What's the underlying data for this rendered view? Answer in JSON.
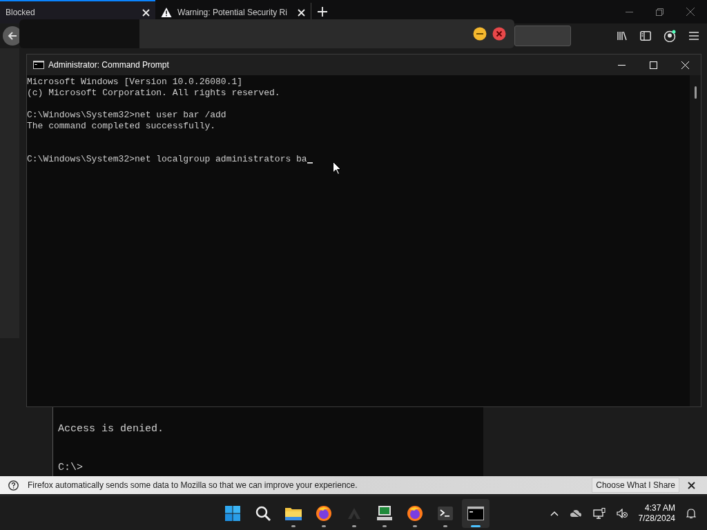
{
  "browser": {
    "tabs": [
      {
        "label": "Blocked",
        "selected": true,
        "kind": "plain"
      },
      {
        "label": "Warning: Potential Security Ri",
        "selected": false,
        "kind": "warning"
      }
    ]
  },
  "notification": {
    "message": "Firefox automatically sends some data to Mozilla so that we can improve your experience.",
    "button": "Choose What I Share"
  },
  "background_console": {
    "lines": [
      "Access is denied.",
      "C:\\>"
    ]
  },
  "command_prompt": {
    "title": "Administrator: Command Prompt",
    "cursor_visible": true,
    "lines": [
      {
        "kind": "text",
        "text": "Microsoft Windows [Version 10.0.26080.1]"
      },
      {
        "kind": "text",
        "text": "(c) Microsoft Corporation. All rights reserved."
      },
      {
        "kind": "blank"
      },
      {
        "kind": "text",
        "text": "C:\\Windows\\System32>net user bar /add"
      },
      {
        "kind": "text",
        "text": "The command completed successfully."
      },
      {
        "kind": "blank"
      },
      {
        "kind": "blank"
      },
      {
        "kind": "text",
        "text": "C:\\Windows\\System32>net localgroup administrators ba"
      }
    ]
  },
  "taskbar": {
    "apps": [
      {
        "kind": "start",
        "selected": false,
        "running": false
      },
      {
        "kind": "search",
        "selected": false,
        "running": false
      },
      {
        "kind": "folder",
        "selected": false,
        "running": true
      },
      {
        "kind": "browser",
        "selected": false,
        "running": true
      },
      {
        "kind": "triangles",
        "selected": false,
        "running": true
      },
      {
        "kind": "computer",
        "selected": false,
        "running": true
      },
      {
        "kind": "browser",
        "selected": false,
        "running": true
      },
      {
        "kind": "terminal",
        "selected": false,
        "running": true
      },
      {
        "kind": "console",
        "selected": true,
        "running": true
      }
    ],
    "time": "4:37 AM",
    "date": "7/28/2024"
  }
}
